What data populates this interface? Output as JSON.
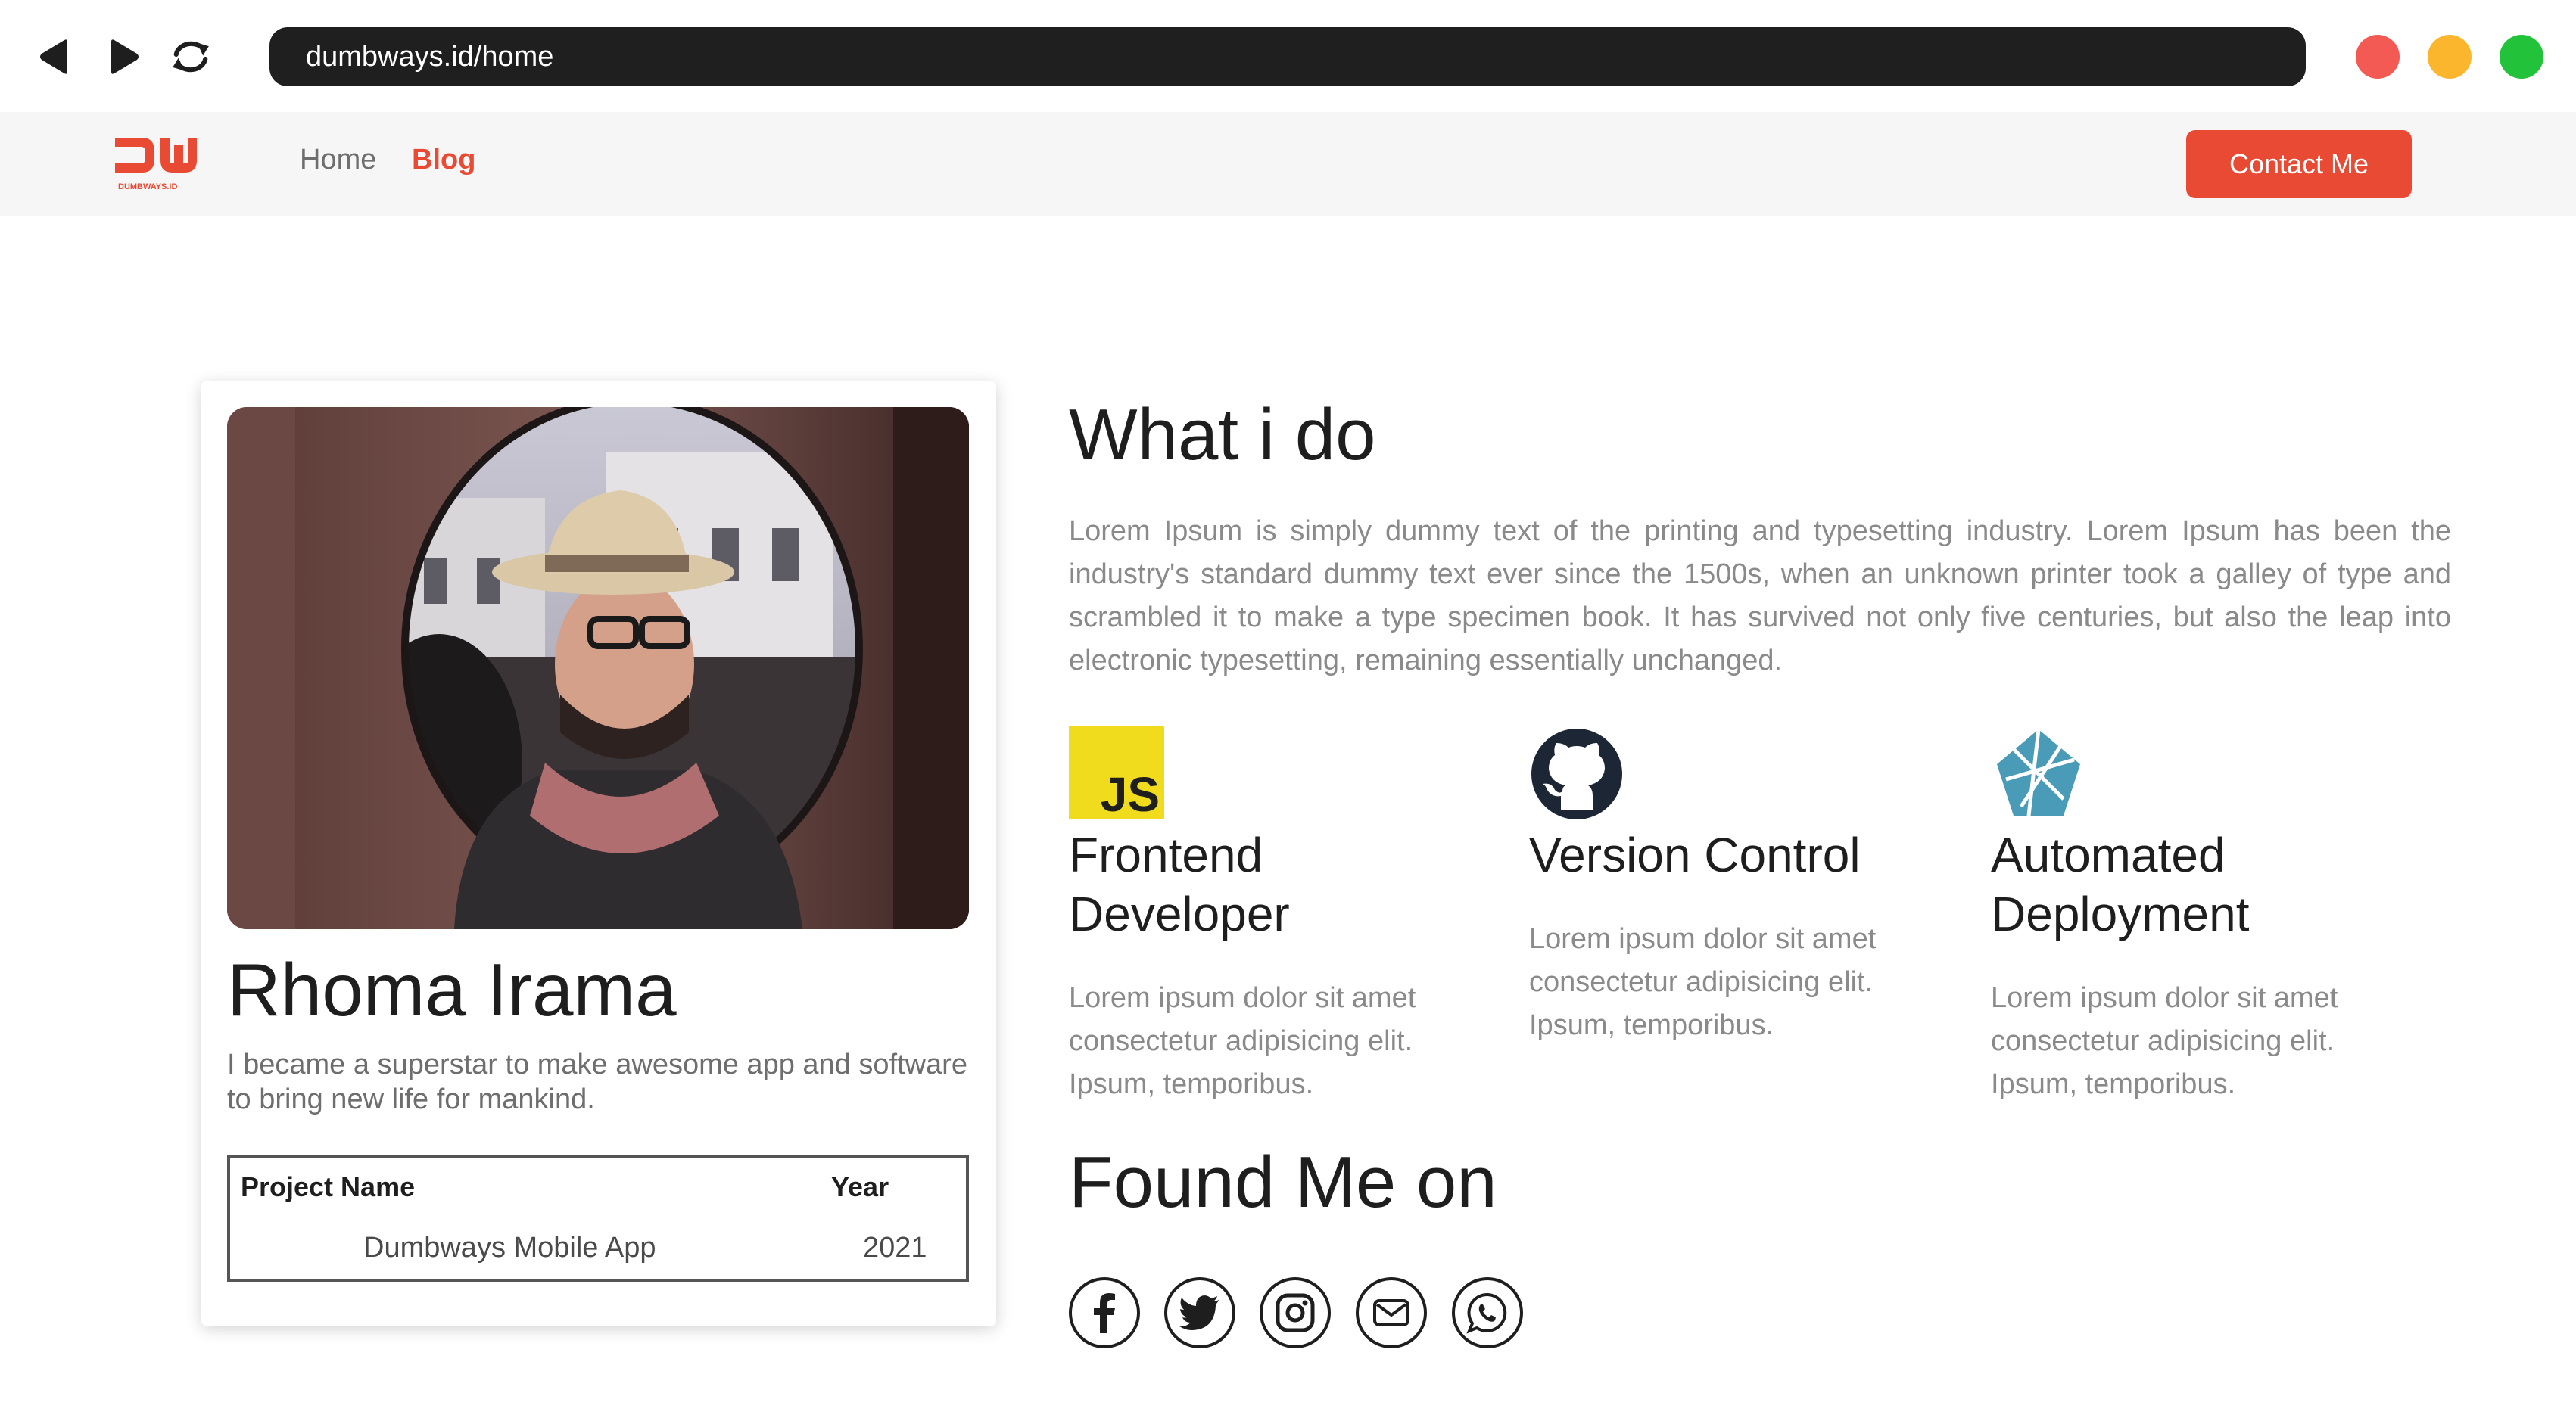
{
  "browser": {
    "url": "dumbways.id/home",
    "dot_colors": [
      "#f35a53",
      "#fbb62e",
      "#22c33b"
    ]
  },
  "nav": {
    "logo_text": "DW",
    "logo_sub": "DUMBWAYS.ID",
    "home": "Home",
    "blog": "Blog",
    "contact": "Contact Me"
  },
  "profile": {
    "name": "Rhoma Irama",
    "bio": "I became a superstar to make awesome app and software to bring new life for mankind.",
    "table": {
      "headers": [
        "Project Name",
        "Year"
      ],
      "rows": [
        [
          "Dumbways Mobile App",
          "2021"
        ]
      ]
    }
  },
  "what": {
    "title": "What i do",
    "text": "Lorem Ipsum is simply dummy text of the printing and typesetting industry. Lorem Ipsum has been the industry's standard dummy text ever since the 1500s, when an unknown printer took a galley of type and scrambled it to make a type specimen book. It has survived not only five centuries, but also the leap into electronic typesetting, remaining essentially unchanged."
  },
  "skills": [
    {
      "icon": "javascript-icon",
      "icon_text": "JS",
      "title": "Frontend Developer",
      "desc": "Lorem ipsum dolor sit amet consectetur adipisicing elit. Ipsum, temporibus."
    },
    {
      "icon": "github-icon",
      "title": "Version Control",
      "desc": "Lorem ipsum dolor sit amet consectetur adipisicing elit. Ipsum, temporibus."
    },
    {
      "icon": "netlify-icon",
      "title": "Automated Deployment",
      "desc": "Lorem ipsum dolor sit amet consectetur adipisicing elit. Ipsum, temporibus."
    }
  ],
  "found": {
    "title": "Found Me on",
    "icons": [
      "facebook-icon",
      "twitter-icon",
      "instagram-icon",
      "mail-icon",
      "whatsapp-icon"
    ]
  },
  "colors": {
    "accent": "#e84a33",
    "url_bar": "#1f1f1f",
    "nav_bg": "#f6f6f6",
    "js_yellow": "#f0db1c"
  }
}
